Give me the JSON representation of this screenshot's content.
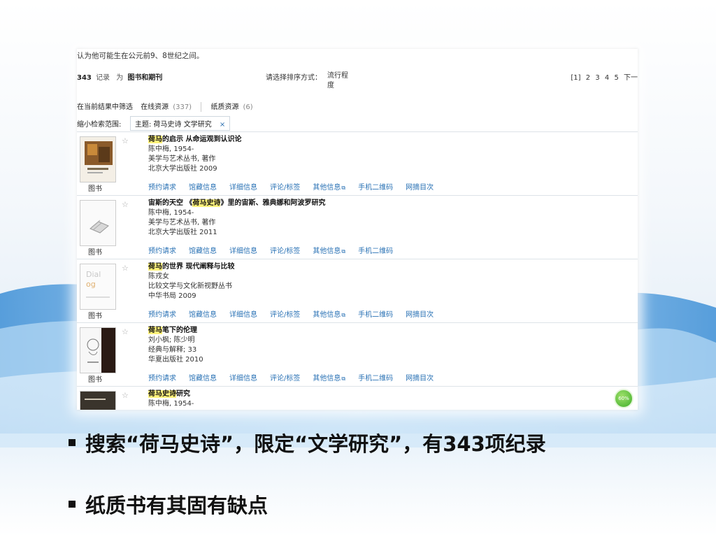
{
  "screenshot": {
    "top_text": "认为他可能生在公元前9、8世纪之间。",
    "header": {
      "count": "343",
      "record_label": "记录",
      "for_label": "为",
      "category": "图书和期刊",
      "sort_label": "请选择排序方式：",
      "sort_value": "流行程度",
      "pager": [
        "[1]",
        "2",
        "3",
        "4",
        "5",
        "下一"
      ]
    },
    "filter": {
      "label": "在当前结果中筛选",
      "online": "在线资源",
      "online_count": "(337)",
      "paper": "纸质资源",
      "paper_count": "(6)"
    },
    "scope": {
      "label": "缩小检索范围:",
      "chip": "主题: 荷马史诗 文学研究",
      "close": "×"
    },
    "records": [
      {
        "title_hl": "荷马",
        "title_rest": "的启示 从命运观到认识论",
        "author": "陈中梅, 1954-",
        "series": "美学与艺术丛书, 著作",
        "publisher": "北京大学出版社 2009",
        "type": "图书",
        "links": [
          "预约请求",
          "馆藏信息",
          "详细信息",
          "评论/标签",
          "其他信息",
          "手机二维码",
          "网摘目次"
        ]
      },
      {
        "title_pre": "宙斯的天空 《",
        "title_hl": "荷马史诗",
        "title_rest": "》里的宙斯、雅典娜和阿波罗研究",
        "author": "陈中梅, 1954-",
        "series": "美学与艺术丛书, 著作",
        "publisher": "北京大学出版社 2011",
        "type": "图书",
        "links": [
          "预约请求",
          "馆藏信息",
          "详细信息",
          "评论/标签",
          "其他信息",
          "手机二维码"
        ]
      },
      {
        "title_hl": "荷马",
        "title_rest": "的世界 现代阐释与比较",
        "author": "陈戎女",
        "series": "比较文学与文化新视野丛书",
        "publisher": "中华书局 2009",
        "type": "图书",
        "links": [
          "预约请求",
          "馆藏信息",
          "详细信息",
          "评论/标签",
          "其他信息",
          "手机二维码",
          "网摘目次"
        ]
      },
      {
        "title_hl": "荷马",
        "title_rest": "笔下的伦理",
        "author": "刘小枫; 陈少明",
        "series": "经典与解释; 33",
        "publisher": "华夏出版社 2010",
        "type": "图书",
        "links": [
          "预约请求",
          "馆藏信息",
          "详细信息",
          "评论/标签",
          "其他信息",
          "手机二维码",
          "网摘目次"
        ]
      },
      {
        "title_hl": "荷马史诗",
        "title_rest": "研究",
        "author": "陈中梅, 1954-",
        "series": "",
        "publisher": "",
        "type": "",
        "links": []
      }
    ],
    "progress_badge": "60%"
  },
  "bullets": [
    "搜索“荷马史诗”，限定“文学研究”，有343项纪录",
    "纸质书有其固有缺点"
  ],
  "colors": {
    "link": "#2a72b5",
    "highlight": "#fff27a",
    "wave_blue": "#5aa8e0"
  }
}
